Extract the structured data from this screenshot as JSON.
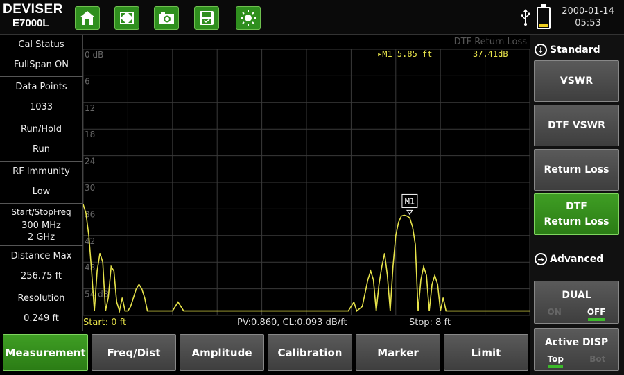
{
  "header": {
    "brand": "DEVISER",
    "model": "E7000L",
    "date": "2000-01-14",
    "time": "05:53",
    "toolbar": [
      {
        "icon": "home-icon"
      },
      {
        "icon": "fullscreen-icon"
      },
      {
        "icon": "camera-icon"
      },
      {
        "icon": "save-icon"
      },
      {
        "icon": "brightness-icon"
      }
    ],
    "status_icons": [
      "usb-icon",
      "battery-icon"
    ],
    "battery_level": 0.15
  },
  "left_panel": [
    {
      "label": "Cal Status",
      "value": "FullSpan ON"
    },
    {
      "label": "Data Points",
      "value": "1033"
    },
    {
      "label": "Run/Hold",
      "value": "Run"
    },
    {
      "label": "RF Immunity",
      "value": "Low"
    },
    {
      "label": "Start/StopFreq",
      "value": "300  MHz",
      "value2": "2  GHz"
    },
    {
      "label": "Distance Max",
      "value": "256.75 ft"
    },
    {
      "label": "Resolution",
      "value": "0.249 ft"
    }
  ],
  "trace": {
    "title": "DTF Return Loss",
    "y_labels": [
      "0 dB",
      "6",
      "12",
      "18",
      "24",
      "30",
      "36",
      "42",
      "48",
      "54 dB"
    ],
    "marker_name": "M1",
    "marker_readout": "M1  5.85 ft",
    "marker_value": "37.41dB",
    "start": "Start: 0 ft",
    "pv_cl": "PV:0.860, CL:0.093 dB/ft",
    "stop": "Stop: 8 ft",
    "trace_color": "#e7e34a",
    "grid_color": "#3a3a3a"
  },
  "chart_data": {
    "type": "line",
    "title": "DTF Return Loss",
    "xlabel": "",
    "ylabel": "",
    "xlim": [
      0,
      8
    ],
    "ylim": [
      0,
      60
    ],
    "y_inverted": true,
    "grid": true,
    "series": [
      {
        "x": [
          0,
          0.05,
          0.1,
          0.15,
          0.2,
          0.25,
          0.3,
          0.35,
          0.4,
          0.45,
          0.5,
          0.55,
          0.6,
          0.65,
          0.7,
          0.75,
          0.8,
          0.85,
          0.9,
          0.95,
          1.0,
          1.05,
          1.1,
          1.15,
          1.2,
          1.25,
          1.3,
          1.35,
          1.4,
          1.45,
          1.5,
          1.6,
          1.7,
          1.8,
          1.9,
          2.0,
          2.1,
          2.2,
          2.3,
          2.4,
          2.5,
          2.6,
          2.7,
          2.8,
          2.9,
          3.0,
          3.5,
          4.0,
          4.5,
          4.75,
          4.85,
          4.9,
          5.0,
          5.1,
          5.15,
          5.2,
          5.25,
          5.3,
          5.35,
          5.4,
          5.45,
          5.5,
          5.55,
          5.6,
          5.65,
          5.7,
          5.75,
          5.8,
          5.85,
          5.9,
          5.95,
          6.0,
          6.05,
          6.1,
          6.15,
          6.2,
          6.25,
          6.3,
          6.35,
          6.4,
          6.45,
          6.5,
          6.55,
          6.6,
          6.65,
          6.7,
          6.75,
          6.8,
          6.85,
          6.9,
          7.0,
          7.2,
          7.5,
          8.0
        ],
        "y": [
          35,
          37,
          42,
          50,
          59,
          50,
          46,
          48,
          59,
          56,
          49,
          50,
          57,
          59,
          56,
          59,
          59,
          58,
          56,
          54,
          53,
          54,
          56,
          59,
          59,
          59,
          59,
          59,
          59,
          59,
          59,
          59,
          57,
          59,
          59,
          59,
          59,
          59,
          59,
          59,
          59,
          59,
          59,
          59,
          59,
          59,
          59,
          59,
          59,
          59,
          57,
          59,
          58,
          52,
          50,
          52,
          59,
          53,
          49,
          46,
          51,
          59,
          49,
          42,
          39,
          37.6,
          37.41,
          37.6,
          38,
          40,
          44,
          59,
          52,
          49,
          51,
          59,
          53,
          51,
          53,
          59,
          56,
          59,
          59,
          59,
          59,
          59,
          59,
          59,
          59,
          59,
          59,
          59,
          59,
          59
        ]
      }
    ],
    "markers": [
      {
        "name": "M1",
        "x": 5.85,
        "y": 37.41
      }
    ]
  },
  "softkeys": {
    "standard_header": "Standard",
    "advanced_header": "Advanced",
    "buttons": [
      {
        "label": "VSWR"
      },
      {
        "label": "DTF VSWR"
      },
      {
        "label": "Return Loss"
      },
      {
        "label": "DTF\nReturn Loss"
      }
    ],
    "dual": {
      "label": "DUAL",
      "on": "ON",
      "off": "OFF"
    },
    "active_disp": {
      "label": "Active DISP",
      "top": "Top",
      "bot": "Bot"
    }
  },
  "menu": [
    "Measurement",
    "Freq/Dist",
    "Amplitude",
    "Calibration",
    "Marker",
    "Limit"
  ]
}
